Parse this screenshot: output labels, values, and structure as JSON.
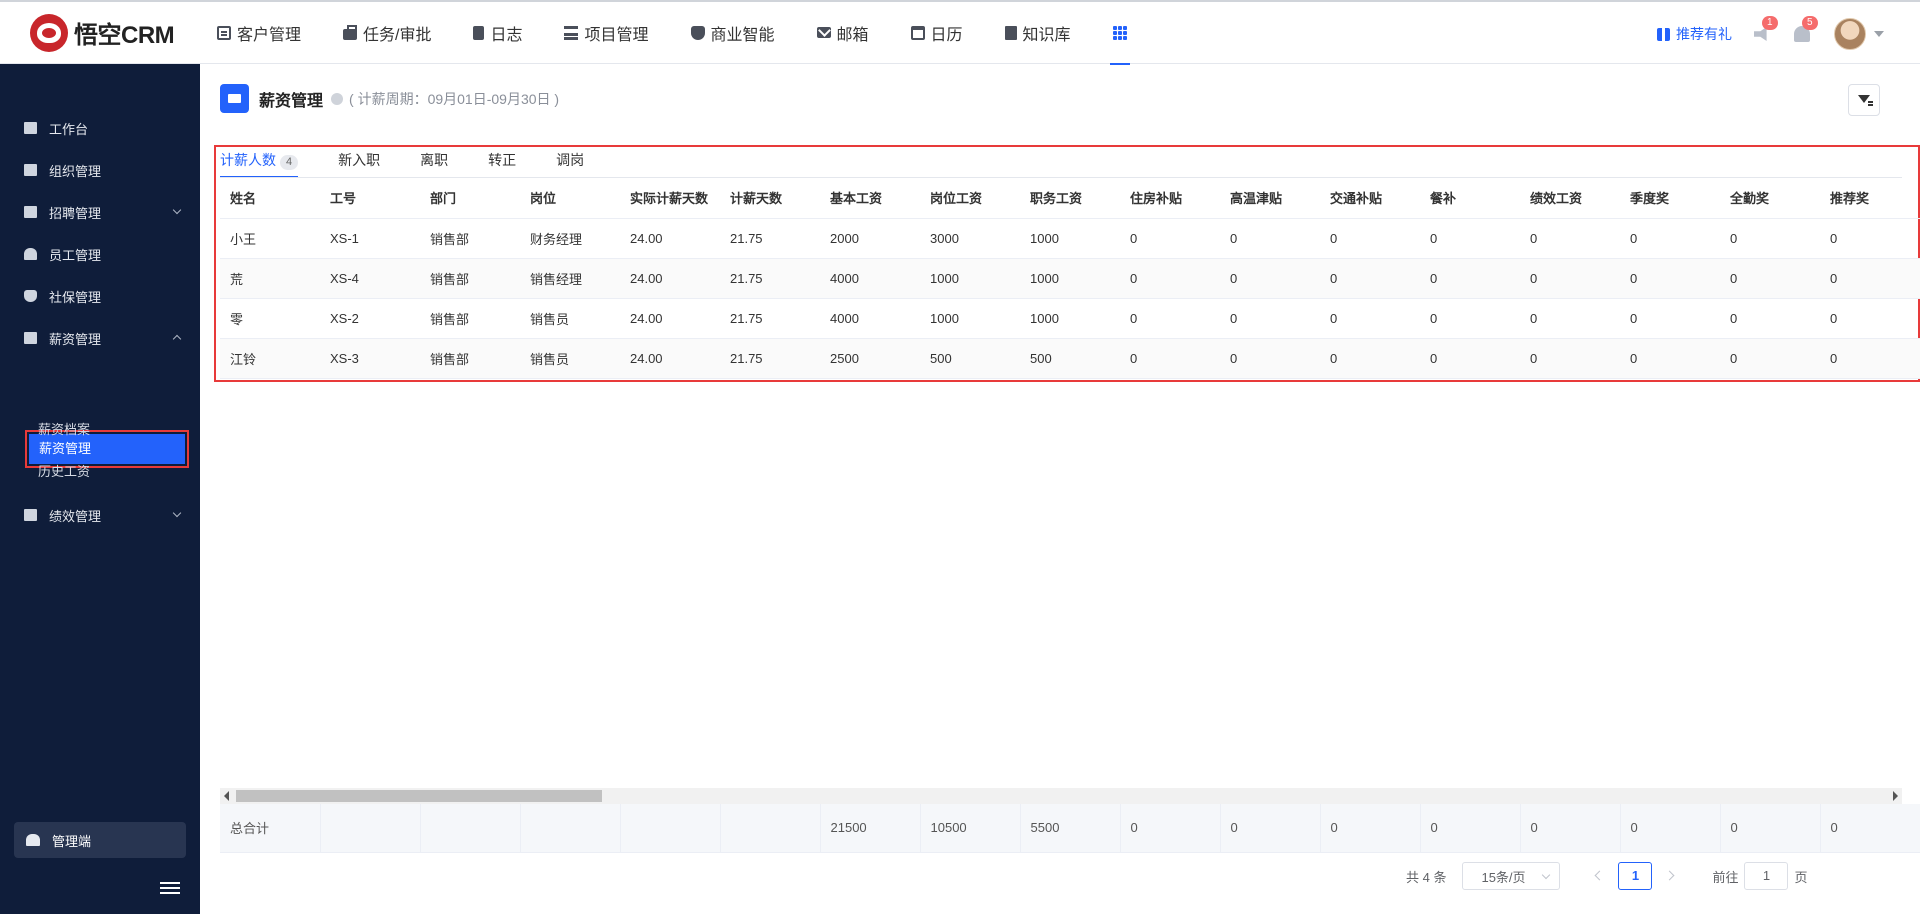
{
  "app": {
    "name": "悟空CRM"
  },
  "nav": [
    {
      "label": "客户管理",
      "icon": "document-icon"
    },
    {
      "label": "任务/审批",
      "icon": "briefcase-icon"
    },
    {
      "label": "日志",
      "icon": "notebook-icon"
    },
    {
      "label": "项目管理",
      "icon": "list-icon"
    },
    {
      "label": "商业智能",
      "icon": "shield-icon"
    },
    {
      "label": "邮箱",
      "icon": "mail-icon"
    },
    {
      "label": "日历",
      "icon": "calendar-icon"
    },
    {
      "label": "知识库",
      "icon": "book-icon"
    }
  ],
  "topright": {
    "gift_label": "推荐有礼",
    "speaker_badge": "1",
    "bell_badge": "5"
  },
  "sidebar": {
    "items": [
      {
        "label": "工作台"
      },
      {
        "label": "组织管理"
      },
      {
        "label": "招聘管理"
      },
      {
        "label": "员工管理"
      },
      {
        "label": "社保管理"
      },
      {
        "label": "薪资管理"
      },
      {
        "label": "绩效管理"
      }
    ],
    "sub_items": [
      {
        "label": "薪资管理"
      },
      {
        "label": "薪资档案"
      },
      {
        "label": "历史工资"
      }
    ],
    "admin_label": "管理端"
  },
  "page": {
    "title": "薪资管理",
    "period": "( 计薪周期：09月01日-09月30日 )"
  },
  "tabs": [
    {
      "label": "计薪人数",
      "count": "4"
    },
    {
      "label": "新入职"
    },
    {
      "label": "离职"
    },
    {
      "label": "转正"
    },
    {
      "label": "调岗"
    }
  ],
  "table": {
    "columns": [
      "姓名",
      "工号",
      "部门",
      "岗位",
      "实际计薪天数",
      "计薪天数",
      "基本工资",
      "岗位工资",
      "职务工资",
      "住房补贴",
      "高温津贴",
      "交通补贴",
      "餐补",
      "绩效工资",
      "季度奖",
      "全勤奖",
      "推荐奖"
    ],
    "rows": [
      [
        "小王",
        "XS-1",
        "销售部",
        "财务经理",
        "24.00",
        "21.75",
        "2000",
        "3000",
        "1000",
        "0",
        "0",
        "0",
        "0",
        "0",
        "0",
        "0",
        "0"
      ],
      [
        "荒",
        "XS-4",
        "销售部",
        "销售经理",
        "24.00",
        "21.75",
        "4000",
        "1000",
        "1000",
        "0",
        "0",
        "0",
        "0",
        "0",
        "0",
        "0",
        "0"
      ],
      [
        "零",
        "XS-2",
        "销售部",
        "销售员",
        "24.00",
        "21.75",
        "4000",
        "1000",
        "1000",
        "0",
        "0",
        "0",
        "0",
        "0",
        "0",
        "0",
        "0"
      ],
      [
        "江铃",
        "XS-3",
        "销售部",
        "销售员",
        "24.00",
        "21.75",
        "2500",
        "500",
        "500",
        "0",
        "0",
        "0",
        "0",
        "0",
        "0",
        "0",
        "0"
      ]
    ],
    "totals": [
      "总合计",
      "",
      "",
      "",
      "",
      "",
      "21500",
      "10500",
      "5500",
      "0",
      "0",
      "0",
      "0",
      "0",
      "0",
      "0",
      "0"
    ]
  },
  "pagination": {
    "total": "共 4 条",
    "page_size": "15条/页",
    "current": "1",
    "goto_label": "前往",
    "goto_value": "1",
    "page_unit": "页"
  }
}
